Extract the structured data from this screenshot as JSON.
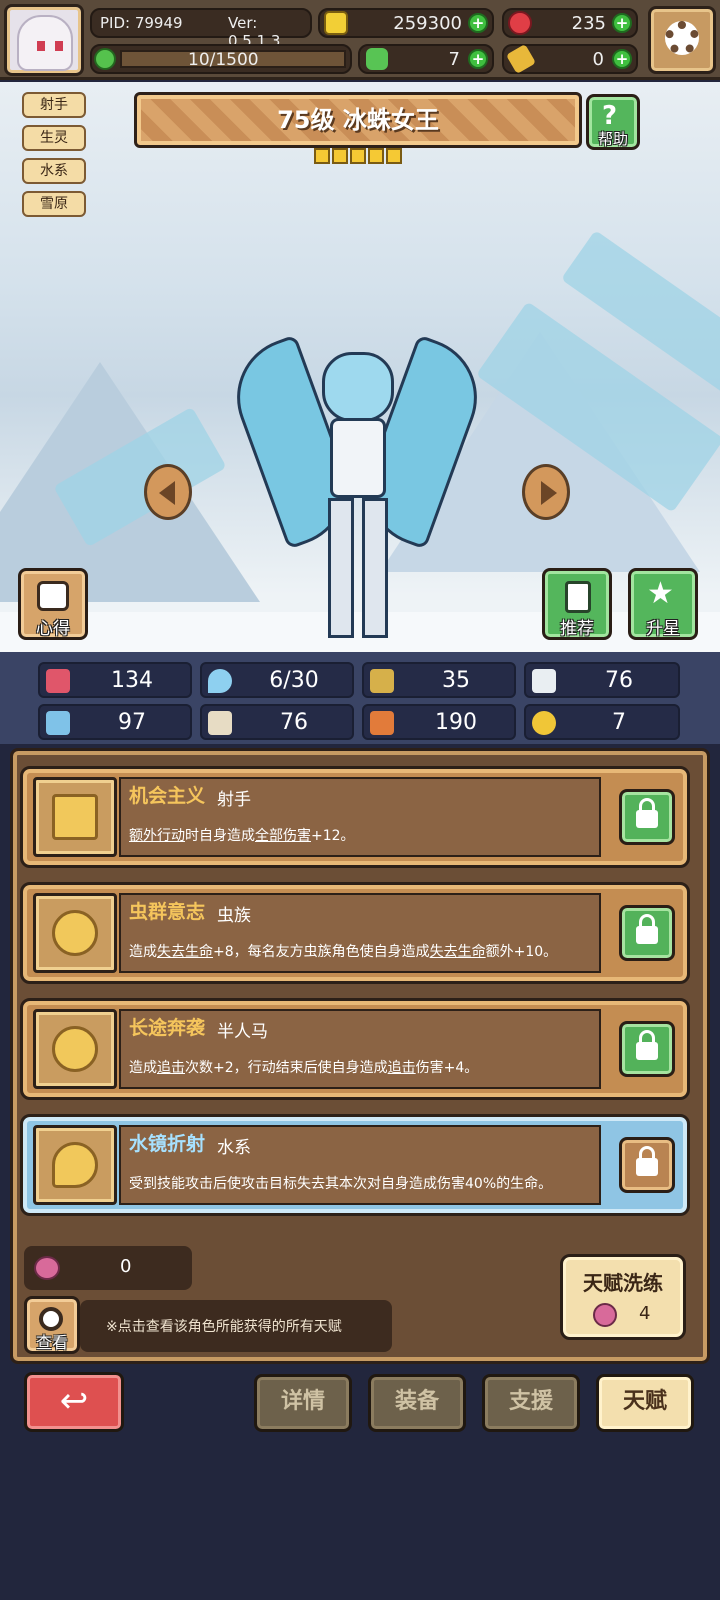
{
  "topbar": {
    "pid": "PID: 79949",
    "version": "Ver: 0.5.1.3",
    "gold": "259300",
    "gems": "235",
    "stamina": "10/1500",
    "clover": "7",
    "key": "0"
  },
  "tags": [
    "射手",
    "生灵",
    "水系",
    "雪原"
  ],
  "hero": {
    "title": "75级 冰蛛女王",
    "stars": 5
  },
  "buttons": {
    "help": "帮助",
    "insight": "心得",
    "recommend": "推荐",
    "star_up": "升星"
  },
  "stats": [
    "134",
    "6/30",
    "35",
    "76",
    "97",
    "76",
    "190",
    "7"
  ],
  "talents": [
    {
      "name": "机会主义",
      "class": "射手",
      "desc_html": "<u>额外行动</u>时自身造成<u>全部伤害</u>+12。",
      "locked": true,
      "active": false
    },
    {
      "name": "虫群意志",
      "class": "虫族",
      "desc_html": "造成<u>失去生命</u>+8，每名友方虫族角色使自身造成<u>失去生命</u>额外+10。",
      "locked": true,
      "active": false
    },
    {
      "name": "长途奔袭",
      "class": "半人马",
      "desc_html": "造成<u>追击</u>次数+2，行动结束后使自身造成<u>追击</u>伤害+4。",
      "locked": true,
      "active": false
    },
    {
      "name": "水镜折射",
      "class": "水系",
      "desc_html": "受到技能攻击后使攻击目标失去其本次对自身造成伤害40%的生命。",
      "locked": false,
      "active": true
    }
  ],
  "bottom": {
    "potion_count": "0",
    "view_label": "查看",
    "hint": "※点击查看该角色所能获得的所有天赋",
    "reroll_label": "天赋洗练",
    "reroll_cost": "4"
  },
  "nav": {
    "details": "详情",
    "equipment": "装备",
    "support": "支援",
    "talent": "天赋"
  },
  "colors": {
    "accent_green": "#54b65c",
    "gold_text": "#f5c55c",
    "bg": "#22263d"
  }
}
